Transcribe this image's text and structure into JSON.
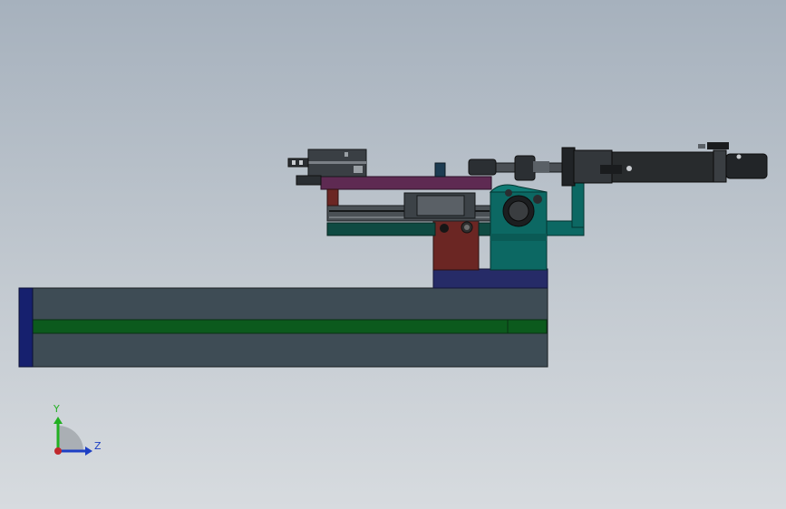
{
  "viewport": {
    "background_top": "#a6b1bd",
    "background_bottom": "#d7dbdf"
  },
  "triad": {
    "y_label": "Y",
    "z_label": "Z",
    "y_color": "#22b022",
    "z_color": "#1d3fc4",
    "origin_color": "#c0282d"
  },
  "colors": {
    "base_plate": "#3e4c55",
    "base_endcap": "#16206e",
    "base_stripe": "#0c5a1d",
    "slide_rail": "#0f4a42",
    "purple_plate": "#5e2a52",
    "red_block": "#6b2623",
    "navy_block": "#262b67",
    "teal_bracket": "#0c6863",
    "cylinder_body": "#282b2d",
    "gripper": "#3a3f44"
  }
}
